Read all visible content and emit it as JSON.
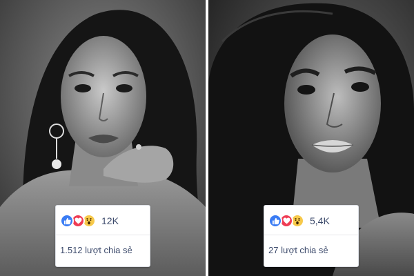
{
  "posts": [
    {
      "reaction_count": "12K",
      "share_text": "1.512 lượt chia sẻ",
      "reactions": [
        "like-icon",
        "love-icon",
        "wow-icon"
      ]
    },
    {
      "reaction_count": "5,4K",
      "share_text": "27 lượt chia sẻ",
      "reactions": [
        "like-icon",
        "love-icon",
        "wow-icon"
      ]
    }
  ],
  "colors": {
    "like": "#3a7cf4",
    "love": "#ef3c54",
    "wow": "#f7c94a",
    "text": "#3c4a6b"
  }
}
